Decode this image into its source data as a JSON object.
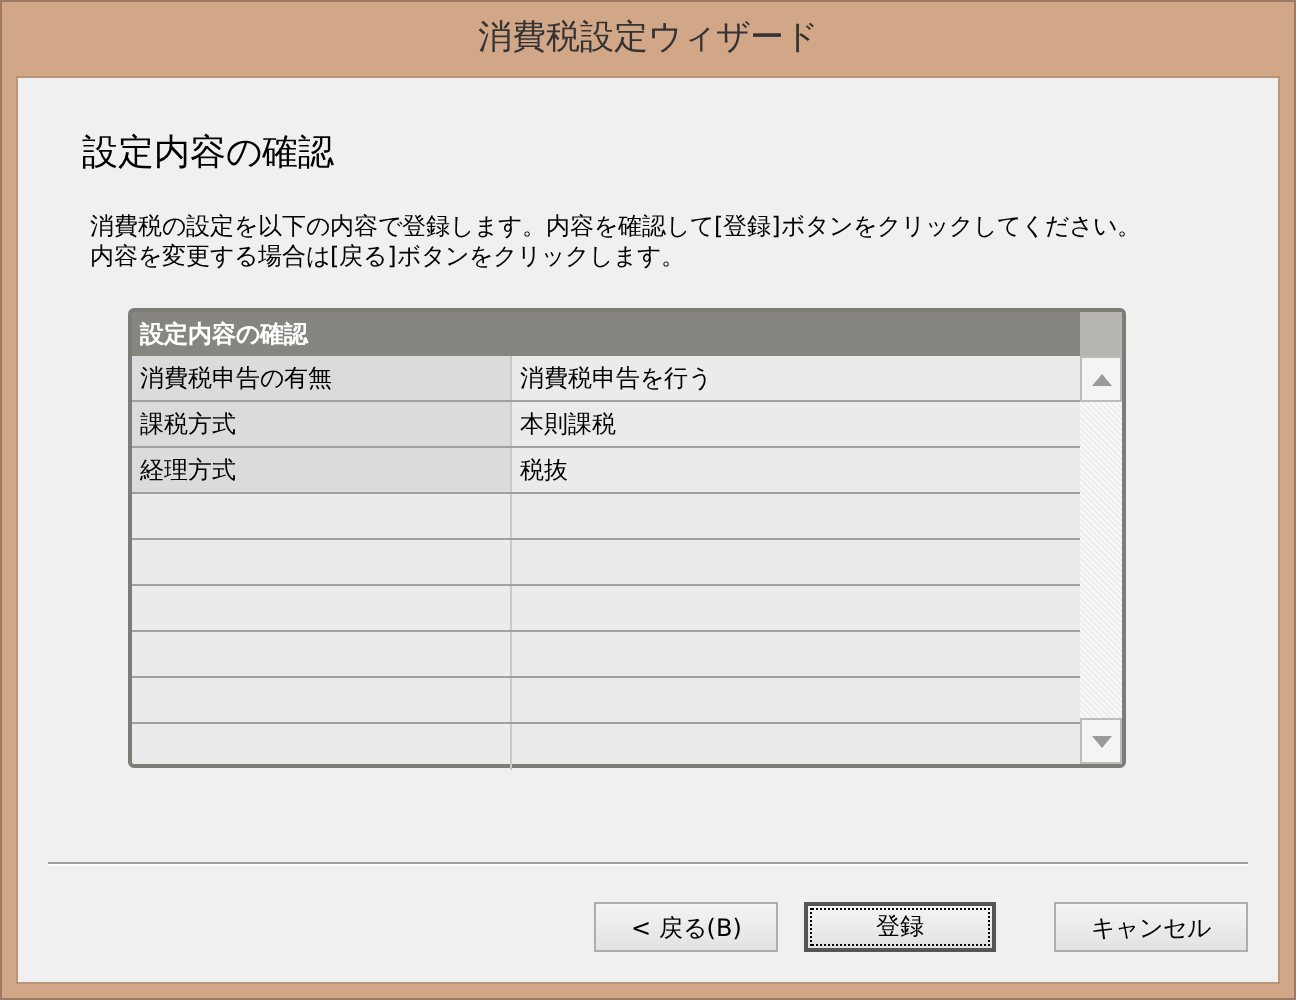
{
  "window": {
    "title": "消費税設定ウィザード"
  },
  "heading": "設定内容の確認",
  "description": [
    "消費税の設定を以下の内容で登録します。内容を確認して[登録]ボタンをクリックしてください。",
    "内容を変更する場合は[戻る]ボタンをクリックします。"
  ],
  "table": {
    "title": "設定内容の確認",
    "rows": [
      {
        "label": "消費税申告の有無",
        "value": "消費税申告を行う"
      },
      {
        "label": "課税方式",
        "value": "本則課税"
      },
      {
        "label": "経理方式",
        "value": "税抜"
      }
    ]
  },
  "buttons": [
    {
      "label": "< 戻る(B)",
      "default": false
    },
    {
      "label": "登録",
      "default": true
    },
    {
      "label": "キャンセル",
      "default": false
    }
  ]
}
